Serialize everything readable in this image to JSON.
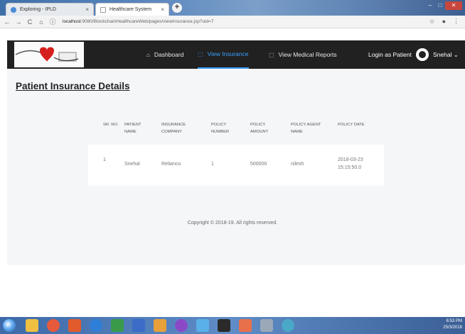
{
  "browser": {
    "tabs": [
      {
        "label": "Exploring - IPLD",
        "close": "×",
        "icon_color": "#4a8ad6"
      },
      {
        "label": "Healthcare System",
        "close": "×",
        "icon_color": "#ffffff"
      }
    ],
    "new_tab": "+",
    "url_host": "localhost",
    "url_path": ":9080/BlockchainHealthcareWeb/pages/viewInsurance.jsp?uid=7",
    "nav": {
      "back": "←",
      "forward": "→",
      "reload": "C",
      "home": "⌂",
      "info": "ⓘ"
    },
    "right": {
      "star": "☆",
      "profile": "●",
      "menu": "⋮"
    },
    "window": {
      "min": "–",
      "max": "□",
      "close": "✕"
    }
  },
  "navbar": {
    "items": [
      {
        "icon": "⌂",
        "label": "Dashboard"
      },
      {
        "icon": "⬚",
        "label": "View Insurance"
      },
      {
        "icon": "⬚",
        "label": "View Medical Reports"
      }
    ],
    "login_text": "Login as Patient",
    "user": "Snehal ⌄"
  },
  "page": {
    "title": "Patient Insurance Details",
    "table": {
      "headers": [
        "SR. NO.",
        "PATIENT NAME",
        "INSURANCE COMPANY",
        "POLICY NUMBER",
        "POLICY AMOUNT",
        "POLICY AGENT NAME",
        "POLICY DATE"
      ],
      "rows": [
        [
          "1",
          "Snehal",
          "Relianco",
          "1",
          "500000",
          "nilesh",
          "2018-03-23 15:15:50.0"
        ]
      ]
    },
    "footer": "Copyright © 2018-19. All rights reserved."
  },
  "taskbar": {
    "time": "6:53 PM",
    "date": "25/3/2018"
  },
  "colors": {
    "navbar": "#212121",
    "accent": "#3aa0ff",
    "content_bg": "#f5f6f8"
  }
}
